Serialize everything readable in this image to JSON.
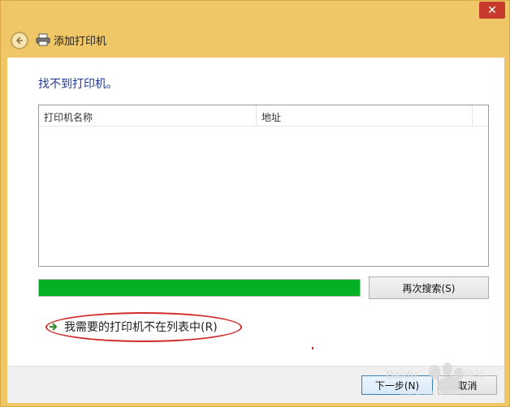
{
  "window": {
    "title": "添加打印机",
    "close_label": "✕"
  },
  "main": {
    "heading": "找不到打印机。",
    "list": {
      "columns": [
        "打印机名称",
        "地址"
      ]
    },
    "progress": {
      "fraction": 1.0,
      "color": "#06b025"
    },
    "search_again_label": "再次搜索(S)",
    "not_listed_label": "我需要的打印机不在列表中(R)"
  },
  "footer": {
    "next_label": "下一步(N)",
    "cancel_label": "取消"
  },
  "colors": {
    "frame": "#f0c766",
    "heading": "#1f3a93",
    "annotation": "#d02b2b"
  },
  "watermark": {
    "text": "Baidu 经验",
    "sub": "jingyan.baidu.com"
  }
}
